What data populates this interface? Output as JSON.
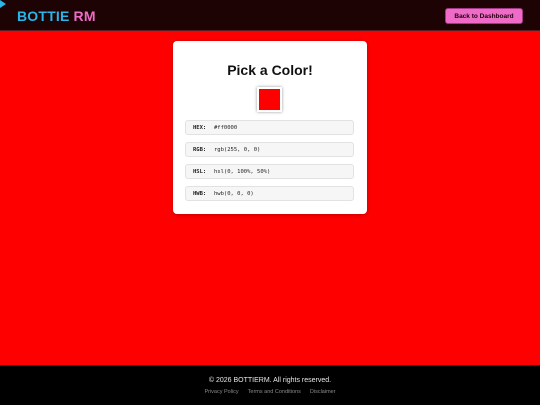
{
  "header": {
    "logo_part1": "BOTTIE",
    "logo_part2": "RM",
    "back_button_label": "Back to Dashboard"
  },
  "card": {
    "title": "Pick a Color!",
    "swatch_color": "#ff0000",
    "rows": [
      {
        "label": "HEX:",
        "value": "#ff0000"
      },
      {
        "label": "RGB:",
        "value": "rgb(255, 0, 0)"
      },
      {
        "label": "HSL:",
        "value": "hsl(0, 100%, 50%)"
      },
      {
        "label": "HWB:",
        "value": "hwb(0, 0, 0)"
      }
    ]
  },
  "footer": {
    "copyright": "© 2026 BOTTIERM. All rights reserved.",
    "links": [
      "Privacy Policy",
      "Terms and Conditions",
      "Disclaimer"
    ]
  },
  "colors": {
    "page_background": "#ff0000",
    "header_background": "#1e0304",
    "logo_blue": "#29b6e8",
    "logo_pink": "#f06bc8",
    "button_pink": "#f06bc8",
    "footer_background": "#000000"
  }
}
